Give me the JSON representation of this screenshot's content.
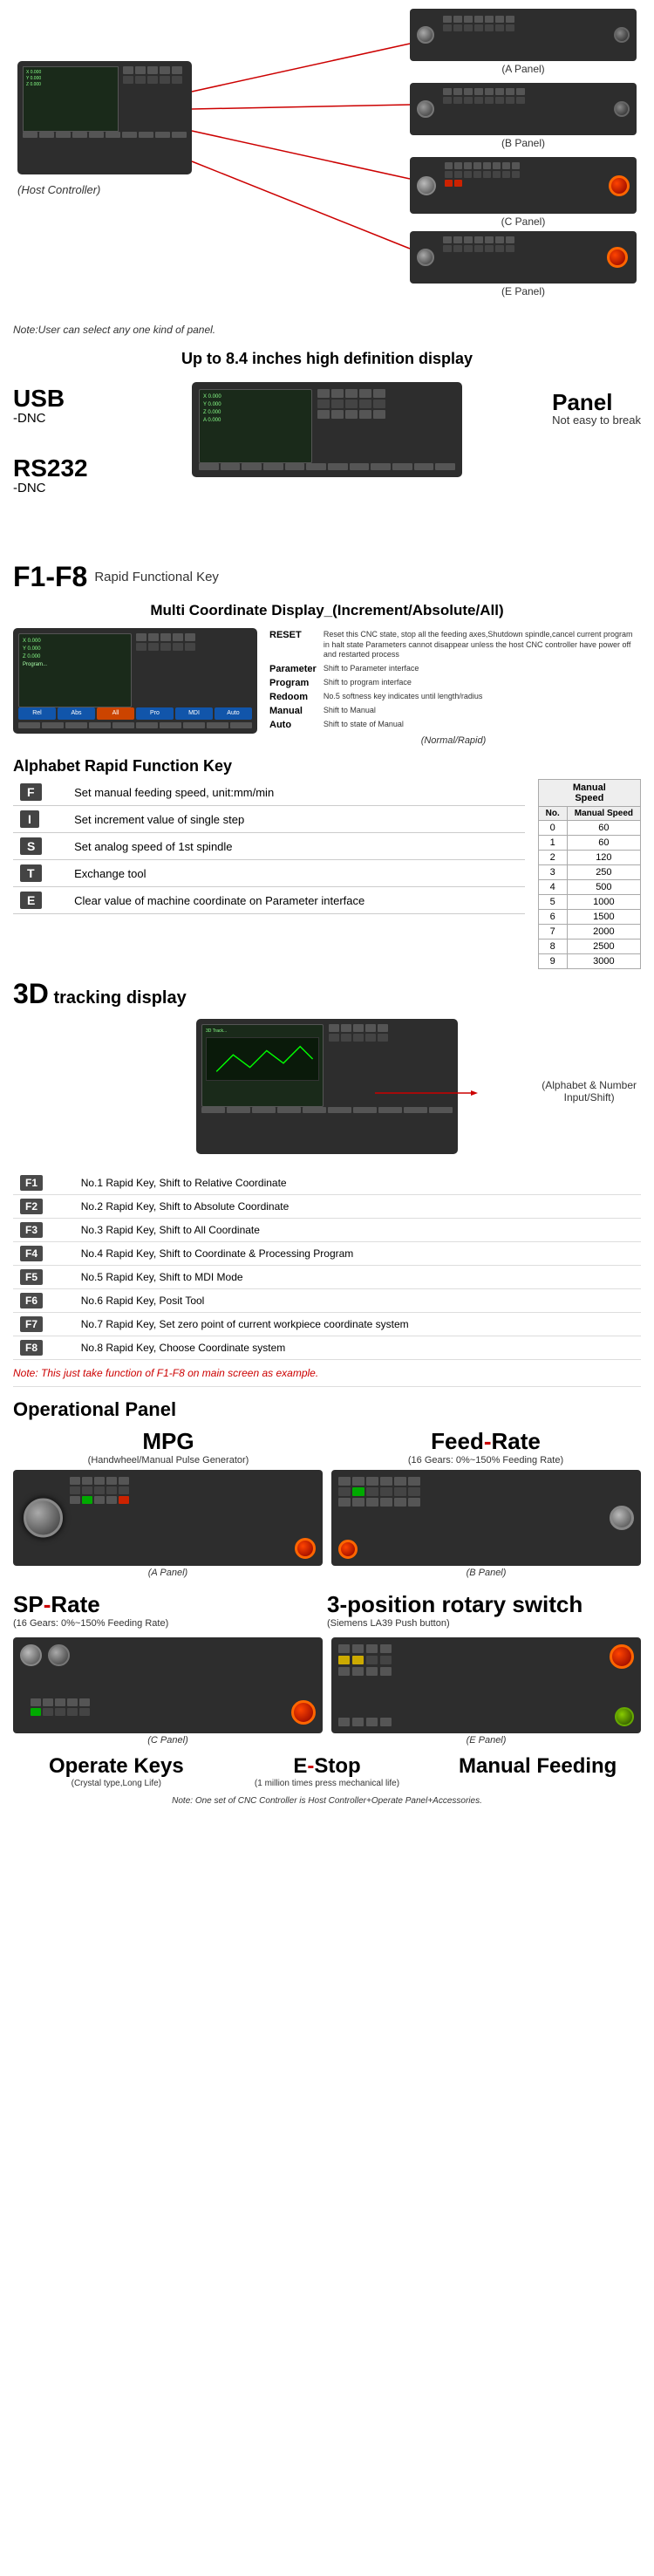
{
  "top": {
    "note": "Note:User can select any one kind of panel.",
    "host_label": "(Host Controller)",
    "panel_a_label": "(A Panel)",
    "panel_b_label": "(B Panel)",
    "panel_c_label": "(C Panel)",
    "panel_e_label": "(E Panel)"
  },
  "features": {
    "display_title": "Up to 8.4 inches high definition display",
    "usb_label": "USB",
    "usb_sub": "-DNC",
    "rs232_label": "RS232",
    "rs232_sub": "-DNC",
    "panel_label": "Panel",
    "panel_sub": "Not easy to break",
    "f1f8_label": "F1-F8",
    "f1f8_desc": "Rapid Functional Key",
    "multi_coord": "Multi Coordinate Display_(Increment/Absolute/All)",
    "normal_rapid": "(Normal/Rapid)"
  },
  "alphabet": {
    "title": "Alphabet Rapid Function Key",
    "rows": [
      {
        "key": "F",
        "desc": "Set manual feeding speed, unit:mm/min"
      },
      {
        "key": "I",
        "desc": "Set increment value of single step"
      },
      {
        "key": "S",
        "desc": "Set analog speed of 1st spindle"
      },
      {
        "key": "T",
        "desc": "Exchange tool"
      },
      {
        "key": "E",
        "desc": "Clear value of machine coordinate on Parameter interface"
      }
    ],
    "speed_table": {
      "title": "Manual Speed",
      "header": [
        "No.",
        "Manual Speed"
      ],
      "rows": [
        [
          "0",
          "60"
        ],
        [
          "1",
          "60"
        ],
        [
          "2",
          "120"
        ],
        [
          "3",
          "250"
        ],
        [
          "4",
          "500"
        ],
        [
          "5",
          "1000"
        ],
        [
          "6",
          "1500"
        ],
        [
          "7",
          "2000"
        ],
        [
          "8",
          "2500"
        ],
        [
          "9",
          "3000"
        ]
      ]
    }
  },
  "tracking": {
    "title_3d": "3D",
    "title_rest": " tracking display",
    "right_label": "(Alphabet & Number\nInput/Shift)"
  },
  "f1f8_table": {
    "rows": [
      {
        "key": "F1",
        "desc": "No.1 Rapid Key, Shift to Relative Coordinate"
      },
      {
        "key": "F2",
        "desc": "No.2 Rapid Key, Shift to Absolute Coordinate"
      },
      {
        "key": "F3",
        "desc": "No.3 Rapid Key, Shift to All Coordinate"
      },
      {
        "key": "F4",
        "desc": "No.4 Rapid Key, Shift to Coordinate & Processing Program"
      },
      {
        "key": "F5",
        "desc": "No.5 Rapid Key, Shift to MDI Mode"
      },
      {
        "key": "F6",
        "desc": "No.6 Rapid Key, Posit Tool"
      },
      {
        "key": "F7",
        "desc": "No.7 Rapid Key, Set zero point of current workpiece coordinate system"
      },
      {
        "key": "F8",
        "desc": "No.8 Rapid Key, Choose Coordinate system"
      }
    ],
    "note": "Note: This just take function of F1-F8 on main screen as example."
  },
  "operational": {
    "title": "Operational Panel",
    "mpg_label": "MPG",
    "mpg_sub": "(Handwheel/Manual Pulse Generator)",
    "feed_label": "Feed",
    "feed_dash": "-",
    "feed_rest": "Rate",
    "feed_sub": "(16 Gears: 0%~150% Feeding Rate)",
    "panel_a": "(A Panel)",
    "panel_b": "(B Panel)",
    "sp_label": "SP",
    "sp_dash": "-",
    "sp_rest": "Rate",
    "sp_sub": "(16 Gears: 0%~150% Feeding Rate)",
    "pos3_label": "3",
    "pos3_rest": "-position rotary switch",
    "pos3_sub": "(Siemens LA39 Push button)",
    "panel_c": "(C Panel)",
    "panel_e": "(E Panel)",
    "operate_label": "Operate",
    "operate_rest": " Keys",
    "operate_sub": "(Crystal type,Long Life)",
    "estop_label": "E",
    "estop_dash": "-",
    "estop_rest": "Stop",
    "estop_sub": "(1 million times press mechanical life)",
    "manual_label": "Manual",
    "manual_rest": " Feeding",
    "bottom_note": "Note: One set of CNC Controller is Host Controller+Operate Panel+Accessories."
  }
}
